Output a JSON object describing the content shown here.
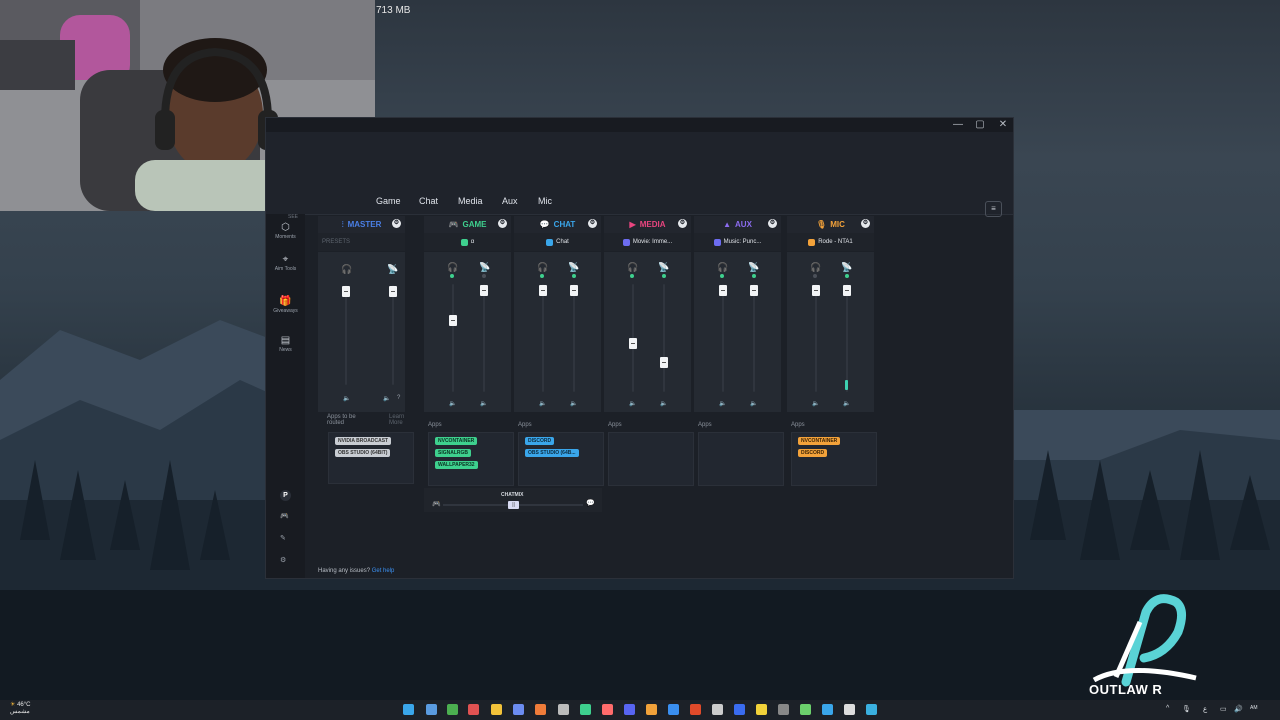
{
  "desktop": {
    "clip_size": "713 MB"
  },
  "window": {
    "controls": {
      "minimize": "—",
      "maximize": "▢",
      "close": "✕"
    },
    "tabs": [
      "Game",
      "Chat",
      "Media",
      "Aux",
      "Mic"
    ],
    "menu_icon": "≡"
  },
  "leftnav": {
    "top_label": "SEE",
    "items": [
      {
        "icon": "⬡",
        "label": "Moments"
      },
      {
        "icon": "⌖",
        "label": "Aim Tools"
      },
      {
        "icon": "🎁",
        "label": "Giveaways"
      },
      {
        "icon": "▤",
        "label": "News"
      }
    ],
    "profile_letter": "P"
  },
  "mixer": {
    "presets_label": "PRESETS",
    "channels": [
      {
        "id": "master",
        "name": "MASTER",
        "icon": "⫶",
        "color": "#4a7fe6",
        "sub": "",
        "sub_color": ""
      },
      {
        "id": "game",
        "name": "GAME",
        "icon": "🎮",
        "color": "#3ed08e",
        "sub": "α",
        "sub_color": "#3ed08e"
      },
      {
        "id": "chat",
        "name": "CHAT",
        "icon": "💬",
        "color": "#3aa6ea",
        "sub": "Chat",
        "sub_color": "#3aa6ea"
      },
      {
        "id": "media",
        "name": "MEDIA",
        "icon": "▶",
        "color": "#e9457f",
        "sub": "Movie: Imme...",
        "sub_color": "#6c6cf0"
      },
      {
        "id": "aux",
        "name": "AUX",
        "icon": "▲",
        "color": "#8c6cf0",
        "sub": "Music: Punc...",
        "sub_color": "#6c6cf0"
      },
      {
        "id": "mic",
        "name": "MIC",
        "icon": "🎙",
        "color": "#f3a23a",
        "sub": "Rode - NTA1",
        "sub_color": "#f3a23a"
      }
    ],
    "master_apps_label": "Apps to be routed",
    "master_learn_more": "Learn More",
    "apps_label": "Apps",
    "chips": {
      "master": [
        "NVIDIA BROADCAST",
        "OBS STUDIO (64BIT)"
      ],
      "game": [
        "NVCONTAINER",
        "SIGNALRGB",
        "WALLPAPER32"
      ],
      "chat": [
        "DISCORD",
        "OBS STUDIO (64B..."
      ],
      "mic": [
        "NVCONTAINER",
        "DISCORD"
      ]
    },
    "chatmix_label": "CHATMIX",
    "issues_text": "Having any issues?",
    "issues_link": "Get help"
  },
  "taskbar": {
    "weather_temp": "46°C",
    "weather_desc": "مشمس",
    "lang": "ع",
    "clock": "AM"
  },
  "watermark": {
    "text": "OUTLAW R"
  }
}
